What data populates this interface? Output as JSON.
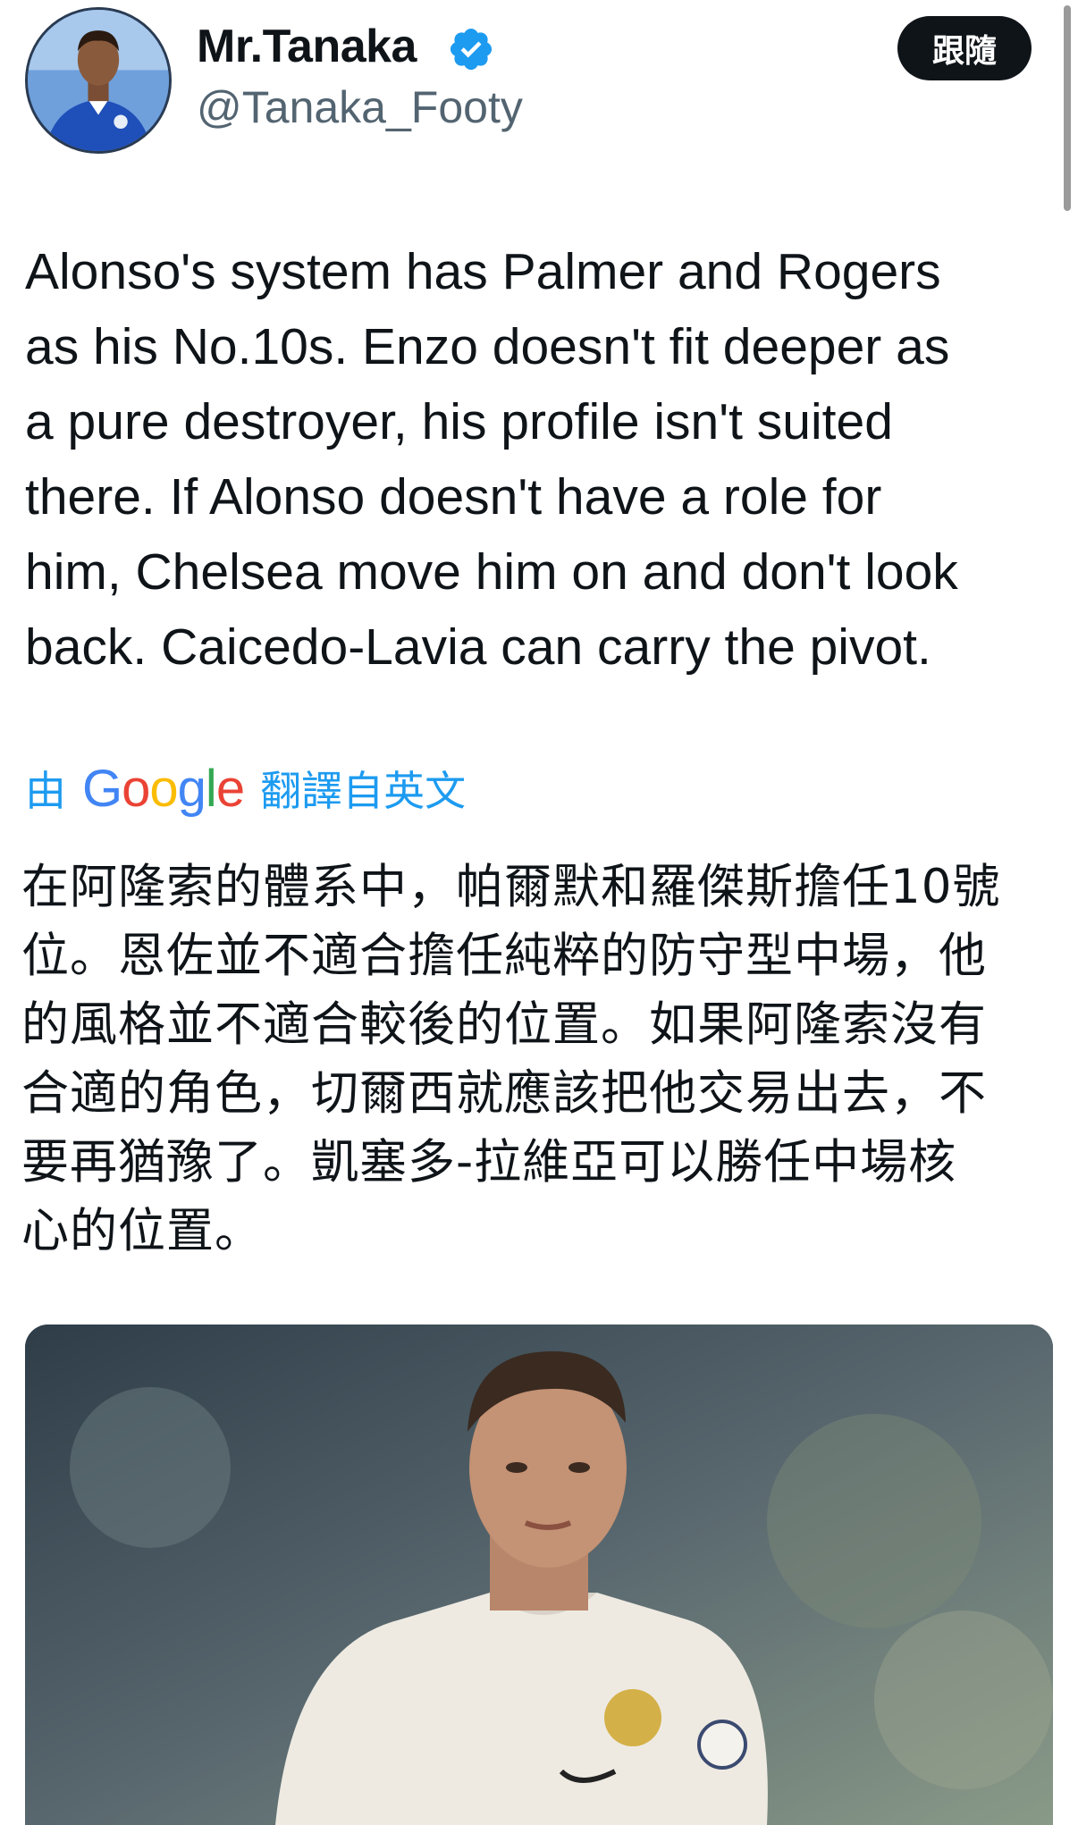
{
  "author": {
    "display_name": "Mr.Tanaka",
    "handle": "@Tanaka_Footy",
    "verified_icon": "verified-badge-icon",
    "verified_color": "#1d9bf0"
  },
  "follow_button": {
    "label": "跟隨"
  },
  "tweet": {
    "text": "Alonso's system has Palmer and Rogers\nas his No.10s. Enzo doesn't fit deeper as\na pure destroyer, his profile isn't suited\nthere. If Alonso doesn't have a role for\nhim, Chelsea move him on and don't look\nback. Caicedo-Lavia can carry the pivot."
  },
  "translation": {
    "prefix": "由",
    "provider_logo": "Google",
    "suffix": "翻譯自英文",
    "text": "在阿隆索的體系中，帕爾默和羅傑斯擔任10號\n位。恩佐並不適合擔任純粹的防守型中場，他\n的風格並不適合較後的位置。如果阿隆索沒有\n合適的角色，切爾西就應該把他交易出去，不\n要再猶豫了。凱塞多-拉維亞可以勝任中場核\n心的位置。"
  },
  "colors": {
    "text_primary": "#0f1419",
    "text_secondary": "#536471",
    "link_blue": "#1d9bf0",
    "button_bg": "#0f1419"
  }
}
